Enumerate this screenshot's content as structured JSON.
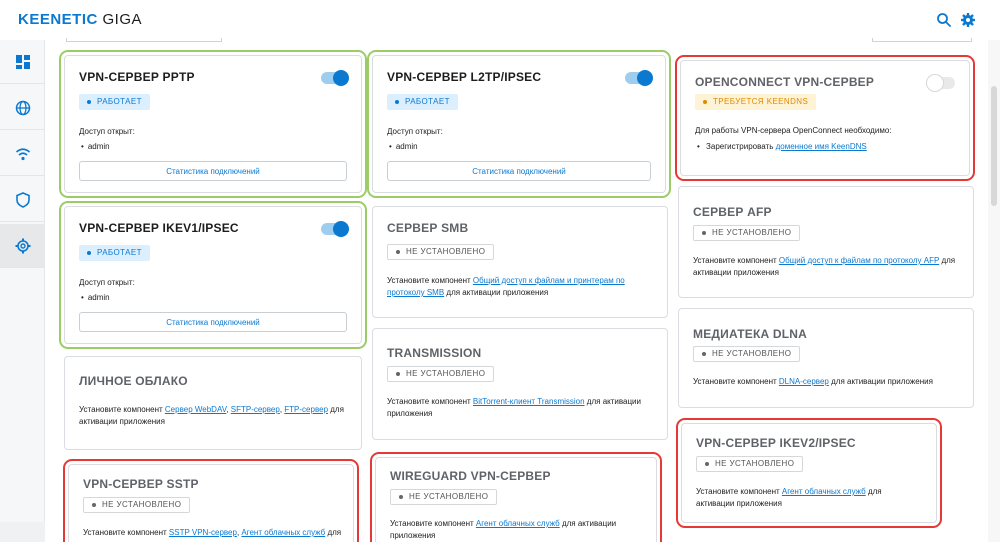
{
  "header": {
    "brand_main": "KEENETIC",
    "brand_model": "GIGA",
    "search_icon": "search-icon",
    "settings_icon": "gear-icon"
  },
  "sidebar": {
    "items": [
      {
        "icon": "dashboard-icon"
      },
      {
        "icon": "globe-icon"
      },
      {
        "icon": "wifi-icon"
      },
      {
        "icon": "shield-icon"
      },
      {
        "icon": "gear-icon",
        "active": true
      }
    ]
  },
  "common": {
    "open_access": "Доступ открыт:",
    "user_admin": "admin",
    "stats_button": "Статистика подключений",
    "working": "РАБОТАЕТ",
    "not_installed": "НЕ УСТАНОВЛЕНО",
    "install_prefix": "Установите компонент",
    "for_activation": "для активации приложения"
  },
  "cards": {
    "pptp": {
      "title": "VPN-СЕРВЕР PPTP"
    },
    "l2tp": {
      "title": "VPN-СЕРВЕР L2TP/IPSEC"
    },
    "openconnect": {
      "title": "OPENCONNECT VPN-СЕРВЕР",
      "badge": "ТРЕБУЕТСЯ KEENDNS",
      "desc": "Для работы VPN-сервера OpenConnect необходимо:",
      "bullet_prefix": "Зарегистрировать",
      "bullet_link": "доменное имя KeenDNS"
    },
    "ikev1": {
      "title": "VPN-СЕРВЕР IKEV1/IPSEC"
    },
    "smb": {
      "title": "СЕРВЕР SMB",
      "link": "Общий доступ к файлам и принтерам по протоколу SMB"
    },
    "afp": {
      "title": "СЕРВЕР AFP",
      "link": "Общий доступ к файлам по протоколу AFP"
    },
    "dlna": {
      "title": "МЕДИАТЕКА DLNA",
      "link": "DLNA-сервер"
    },
    "cloud": {
      "title": "ЛИЧНОЕ ОБЛАКО",
      "link1": "Сервер WebDAV",
      "link2": "SFTP-сервер",
      "link3": "FTP-сервер",
      "tail": "для активации приложения"
    },
    "transmission": {
      "title": "TRANSMISSION",
      "link": "BitTorrent-клиент Transmission"
    },
    "ikev2": {
      "title": "VPN-СЕРВЕР IKEV2/IPSEC",
      "link": "Агент облачных служб"
    },
    "sstp": {
      "title": "VPN-СЕРВЕР SSTP",
      "link1": "SSTP VPN-сервер",
      "link2": "Агент облачных служб",
      "tail": "для"
    },
    "wireguard": {
      "title": "WIREGUARD VPN-СЕРВЕР",
      "link": "Агент облачных служб",
      "tail": "для активации",
      "tail2": "приложения"
    }
  },
  "colors": {
    "accent": "#0b79d0",
    "highlight_green": "#9ccc65",
    "highlight_red": "#e53935"
  }
}
